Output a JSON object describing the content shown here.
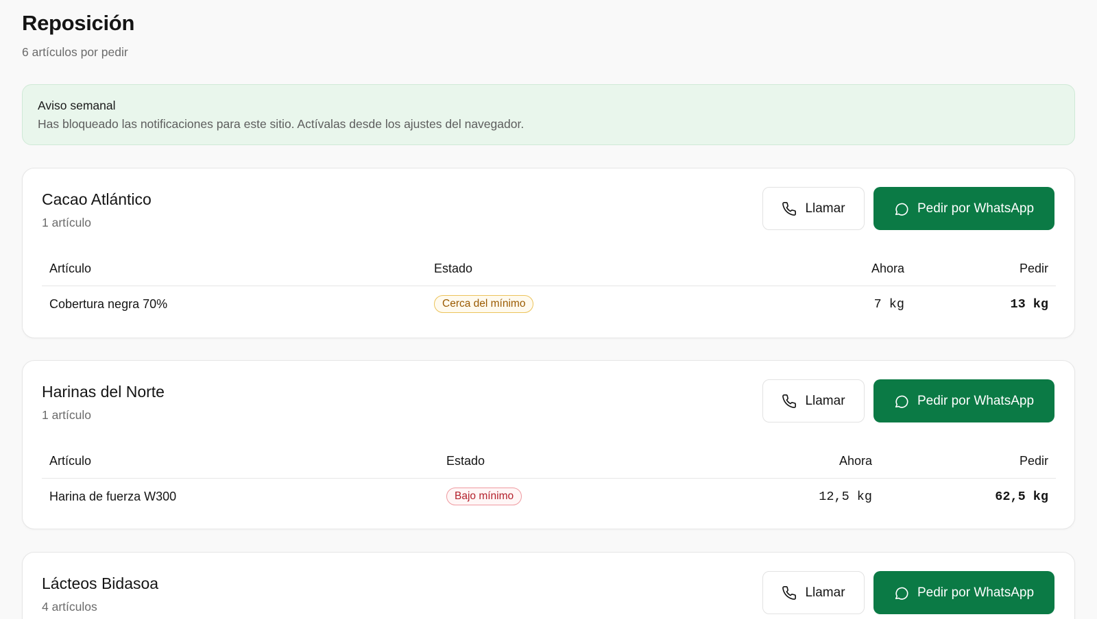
{
  "header": {
    "title": "Reposición",
    "subtitle": "6 artículos por pedir"
  },
  "notice": {
    "title": "Aviso semanal",
    "text": "Has bloqueado las notificaciones para este sitio. Actívalas desde los ajustes del navegador."
  },
  "actions": {
    "call_label": "Llamar",
    "whatsapp_label": "Pedir por WhatsApp"
  },
  "colors": {
    "accent_green": "#0b7a45",
    "notice_bg": "#e9f6ec",
    "badge_warning": "#9a5a00",
    "badge_danger": "#b3202b"
  },
  "icons": {
    "call": "phone-icon",
    "whatsapp": "chat-bubble-icon"
  },
  "suppliers": [
    {
      "name": "Cacao Atlántico",
      "count": "1 artículo",
      "columns": {
        "item": "Artículo",
        "status": "Estado",
        "now": "Ahora",
        "order": "Pedir"
      },
      "rows": [
        {
          "item": "Cobertura negra 70%",
          "status": "Cerca del mínimo",
          "status_type": "warning",
          "now": "7 kg",
          "order": "13 kg"
        }
      ]
    },
    {
      "name": "Harinas del Norte",
      "count": "1 artículo",
      "columns": {
        "item": "Artículo",
        "status": "Estado",
        "now": "Ahora",
        "order": "Pedir"
      },
      "rows": [
        {
          "item": "Harina de fuerza W300",
          "status": "Bajo mínimo",
          "status_type": "danger",
          "now": "12,5 kg",
          "order": "62,5 kg"
        }
      ]
    },
    {
      "name": "Lácteos Bidasoa",
      "count": "4 artículos"
    }
  ]
}
